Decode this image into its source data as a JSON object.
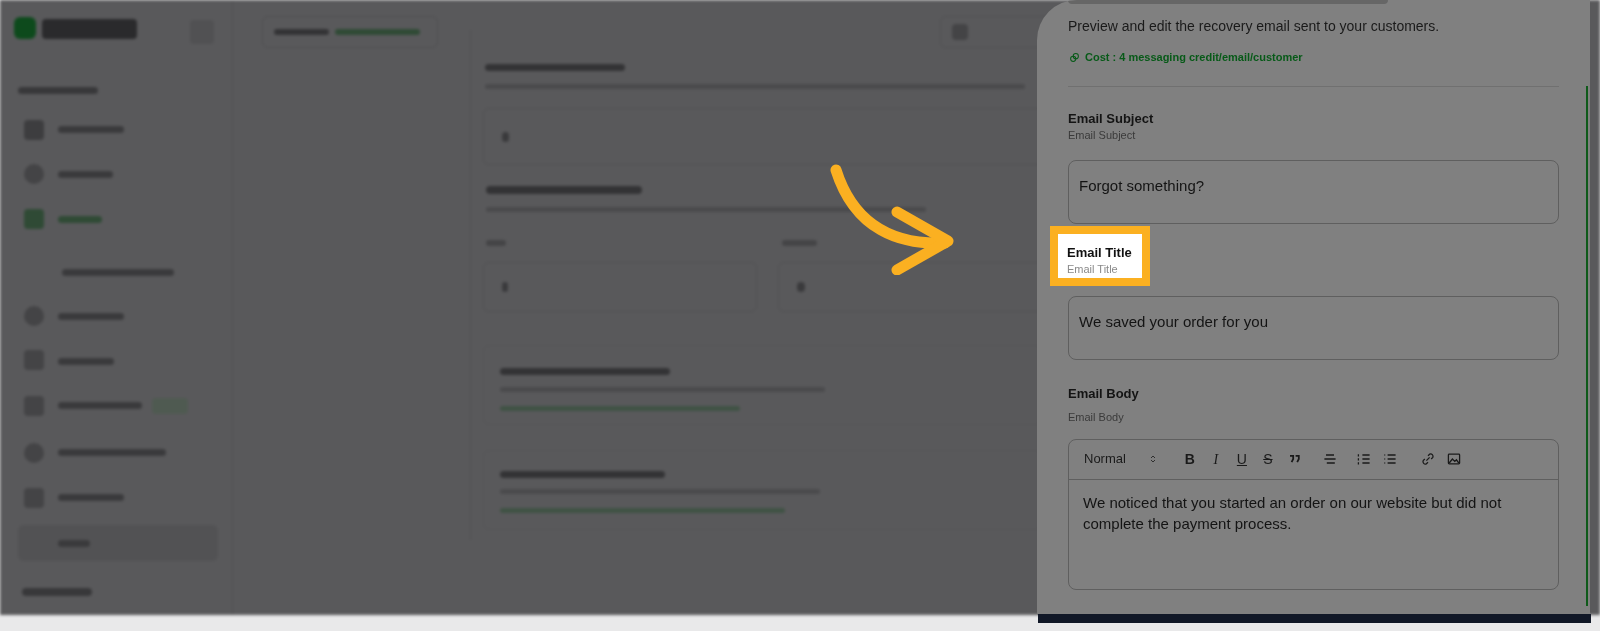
{
  "panel": {
    "subtitle": "Preview and edit the recovery email sent to your customers.",
    "cost": "Cost : 4 messaging credit/email/customer",
    "fields": [
      {
        "label": "Email Subject",
        "hint": "Email Subject",
        "value": "Forgot something?",
        "highlighted": false
      },
      {
        "label": "Email Title",
        "hint": "Email Title",
        "value": "We saved your order for you",
        "highlighted": true
      }
    ],
    "body": {
      "label": "Email Body",
      "hint": "Email Body",
      "format": "Normal",
      "format_buttons": [
        "B",
        "I",
        "U",
        "S"
      ],
      "text": "We noticed that you started an order on our website but did not complete the payment process."
    }
  }
}
